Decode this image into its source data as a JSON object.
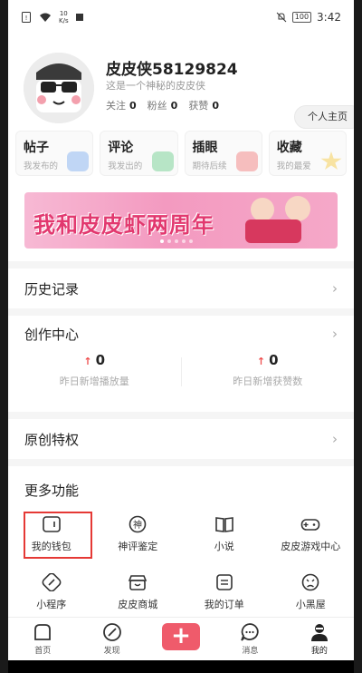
{
  "status_bar": {
    "net_speed": "10",
    "net_unit": "K/s",
    "battery": "100",
    "time": "3:42"
  },
  "profile": {
    "name": "皮皮侠58129824",
    "signature": "这是一个神秘的皮皮侠",
    "follow_label": "关注",
    "follow_count": "0",
    "fans_label": "粉丝",
    "fans_count": "0",
    "likes_label": "获赞",
    "likes_count": "0",
    "homepage_button": "个人主页"
  },
  "quick_cards": [
    {
      "title": "帖子",
      "subtitle": "我发布的",
      "color": "#8fb8f0"
    },
    {
      "title": "评论",
      "subtitle": "我发出的",
      "color": "#7fd39b"
    },
    {
      "title": "插眼",
      "subtitle": "期待后续",
      "color": "#f28c8c"
    },
    {
      "title": "收藏",
      "subtitle": "我的最爱",
      "color": "#f5cf5a"
    }
  ],
  "banner": {
    "text": "我和皮皮虾两周年"
  },
  "history": {
    "label": "历史记录"
  },
  "creation_center": {
    "label": "创作中心",
    "stats": [
      {
        "value": "0",
        "desc": "昨日新增播放量"
      },
      {
        "value": "0",
        "desc": "昨日新增获赞数"
      }
    ]
  },
  "original_privileges": {
    "label": "原创特权"
  },
  "more_features": {
    "title": "更多功能",
    "items": [
      {
        "label": "我的钱包",
        "icon": "wallet-icon"
      },
      {
        "label": "神评鉴定",
        "icon": "shen-badge-icon"
      },
      {
        "label": "小说",
        "icon": "book-icon"
      },
      {
        "label": "皮皮游戏中心",
        "icon": "gamepad-icon"
      },
      {
        "label": "小程序",
        "icon": "link-icon"
      },
      {
        "label": "皮皮商城",
        "icon": "shop-icon"
      },
      {
        "label": "我的订单",
        "icon": "order-icon"
      },
      {
        "label": "小黑屋",
        "icon": "sad-face-icon"
      }
    ]
  },
  "tabbar": {
    "items": [
      {
        "label": "首页",
        "icon": "home-icon"
      },
      {
        "label": "发现",
        "icon": "compass-icon"
      },
      {
        "label": "+",
        "icon": "plus-icon"
      },
      {
        "label": "消息",
        "icon": "message-icon"
      },
      {
        "label": "我的",
        "icon": "user-icon"
      }
    ]
  },
  "colors": {
    "accent": "#ef5b6b",
    "highlight_border": "#e53935"
  }
}
